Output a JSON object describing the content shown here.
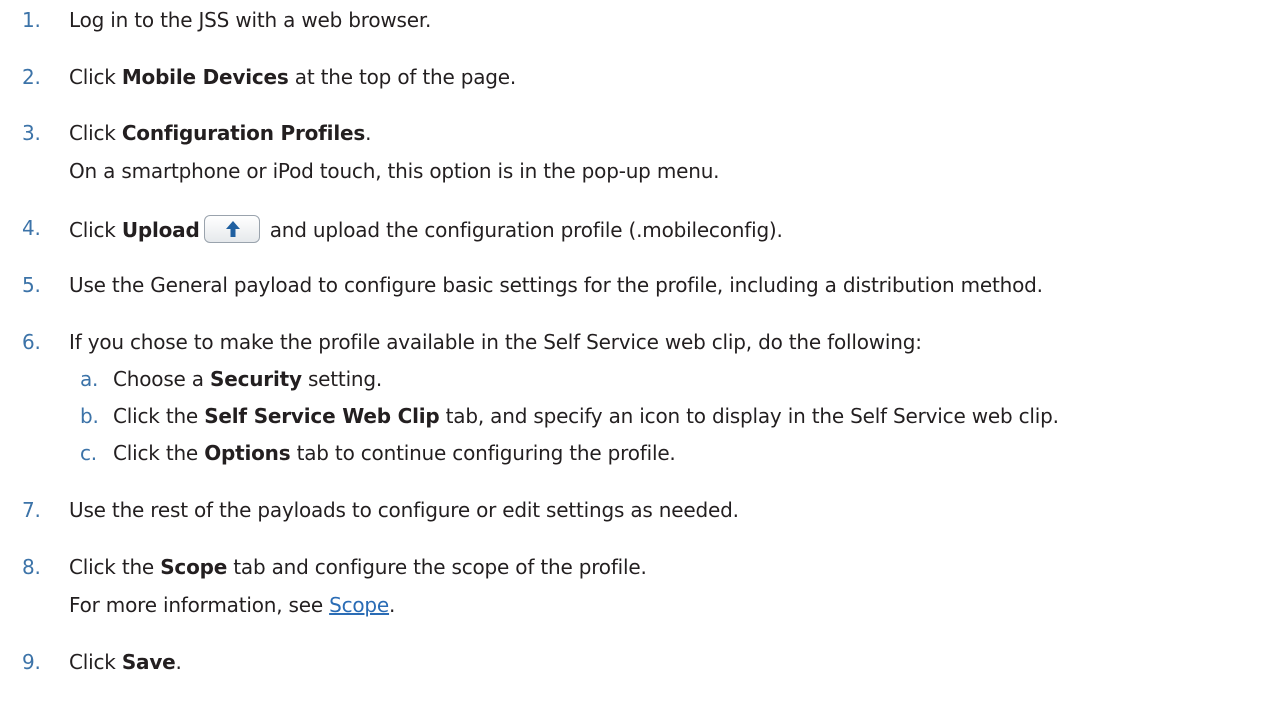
{
  "steps": [
    {
      "num": "1.",
      "text": "Log in to the JSS with a web browser."
    },
    {
      "num": "2.",
      "pre": "Click ",
      "bold": "Mobile Devices",
      "post": " at the top of the page."
    },
    {
      "num": "3.",
      "pre": "Click ",
      "bold": "Configuration Profiles",
      "post": ".",
      "note": "On a smartphone or iPod touch, this option is in the pop-up menu."
    },
    {
      "num": "4.",
      "pre": "Click ",
      "bold": "Upload",
      "post": " and upload the configuration profile (.mobileconfig).",
      "icon": "upload-arrow-icon"
    },
    {
      "num": "5.",
      "text": "Use the General payload to configure basic settings for the profile, including a distribution method."
    },
    {
      "num": "6.",
      "text": "If you chose to make the profile available in the Self Service web clip, do the following:"
    },
    {
      "num": "7.",
      "text": "Use the rest of the payloads to configure or edit settings as needed."
    },
    {
      "num": "8.",
      "pre": "Click the ",
      "bold": "Scope",
      "post": " tab and configure the scope of the profile.",
      "note_pre": "For more information, see ",
      "note_link": "Scope",
      "note_post": "."
    },
    {
      "num": "9.",
      "pre": "Click ",
      "bold": "Save",
      "post": "."
    }
  ],
  "substeps": [
    {
      "num": "a.",
      "pre": "Choose a ",
      "bold": "Security",
      "post": " setting."
    },
    {
      "num": "b.",
      "pre": "Click the ",
      "bold": "Self Service Web Clip",
      "post": " tab, and specify an icon to display in the Self Service web clip."
    },
    {
      "num": "c.",
      "pre": "Click the ",
      "bold": "Options",
      "post": " tab to continue configuring the profile."
    }
  ],
  "colors": {
    "number": "#3c73a8",
    "text": "#231f20",
    "link": "#2a6cb5",
    "upload_arrow": "#1f5fa0"
  }
}
